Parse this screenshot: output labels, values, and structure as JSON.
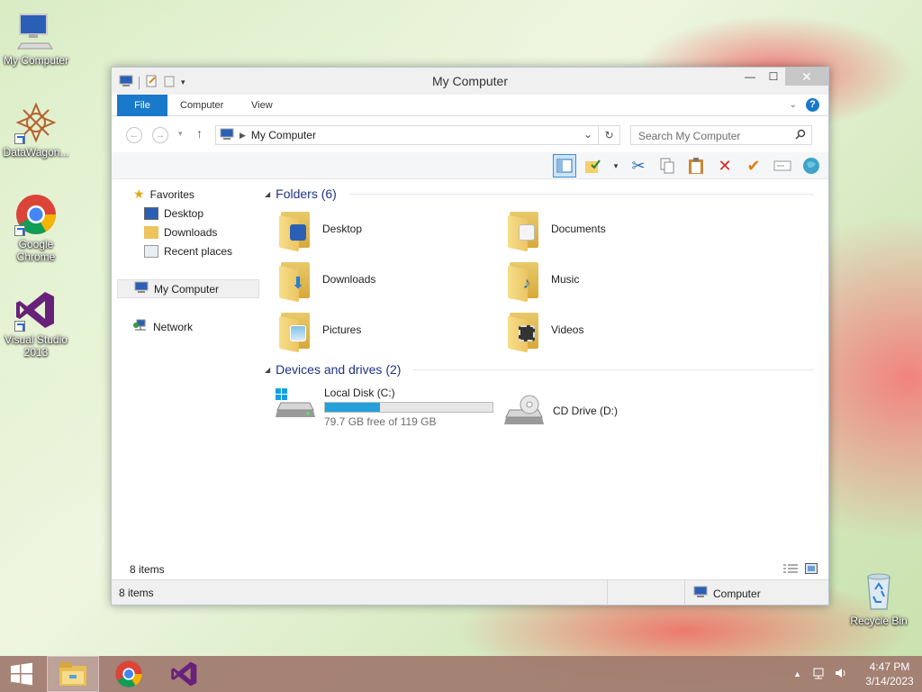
{
  "desktop": {
    "icons": [
      {
        "label": "My Computer"
      },
      {
        "label": "DataWagon..."
      },
      {
        "label": "Google Chrome"
      },
      {
        "label": "Visual Studio 2013"
      },
      {
        "label": "Recycle Bin"
      }
    ]
  },
  "window": {
    "title": "My Computer",
    "ribbon_tabs": [
      "File",
      "Computer",
      "View"
    ],
    "address": "My Computer",
    "search_placeholder": "Search My Computer",
    "sidebar": {
      "favorites": "Favorites",
      "favorite_items": [
        "Desktop",
        "Downloads",
        "Recent places"
      ],
      "computer": "My Computer",
      "network": "Network"
    },
    "folders_header": "Folders (6)",
    "folders": [
      "Desktop",
      "Documents",
      "Downloads",
      "Music",
      "Pictures",
      "Videos"
    ],
    "devices_header": "Devices and drives (2)",
    "drives": [
      {
        "name": "Local Disk (C:)",
        "free": "79.7 GB free of 119 GB",
        "used_fraction": 0.33
      },
      {
        "name": "CD Drive (D:)"
      }
    ],
    "inner_status": "8 items",
    "status_left": "8 items",
    "status_right": "Computer"
  },
  "taskbar": {
    "time": "4:47 PM",
    "date": "3/14/2023"
  }
}
